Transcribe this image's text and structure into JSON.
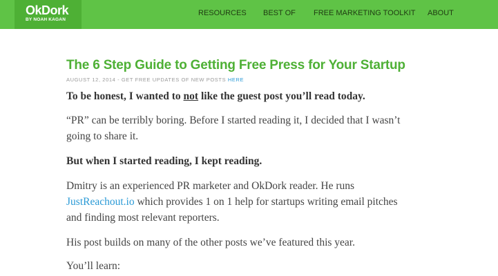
{
  "logo": {
    "name": "OkDork",
    "tagline": "BY NOAH KAGAN"
  },
  "nav": {
    "items": [
      {
        "label": "RESOURCES"
      },
      {
        "label": "BEST OF"
      },
      {
        "label": "FREE MARKETING TOOLKIT"
      },
      {
        "label": "ABOUT"
      }
    ]
  },
  "article": {
    "title": "The 6 Step Guide to Getting Free Press for Your Startup",
    "meta": {
      "date": "AUGUST 12, 2014",
      "separator": " - ",
      "updates_text": "GET FREE UPDATES OF NEW POSTS ",
      "link_label": "HERE"
    },
    "p1": {
      "before": "To be honest, I wanted to ",
      "emph": "not",
      "after": " like the guest post you’ll read today."
    },
    "p2_line1": "“PR” can be terribly boring. Before I started reading it, I decided that I wasn’t",
    "p2_line2": "going to share it.",
    "p3": "But when I started reading, I kept reading.",
    "p4_line1": "Dmitry is an experienced PR marketer and OkDork reader. He runs",
    "p4_link": "JustReachout.io",
    "p4_line2_rest": " which provides 1 on 1 help for startups writing email pitches",
    "p4_line3": "and finding most relevant reporters.",
    "p5": "His post builds on many of the other posts we’ve featured this year.",
    "p6": "You’ll learn:"
  },
  "colors": {
    "header_bg": "#5fc346",
    "logo_bg": "#4eb035",
    "title": "#4eb035",
    "link": "#2a9ad6"
  }
}
